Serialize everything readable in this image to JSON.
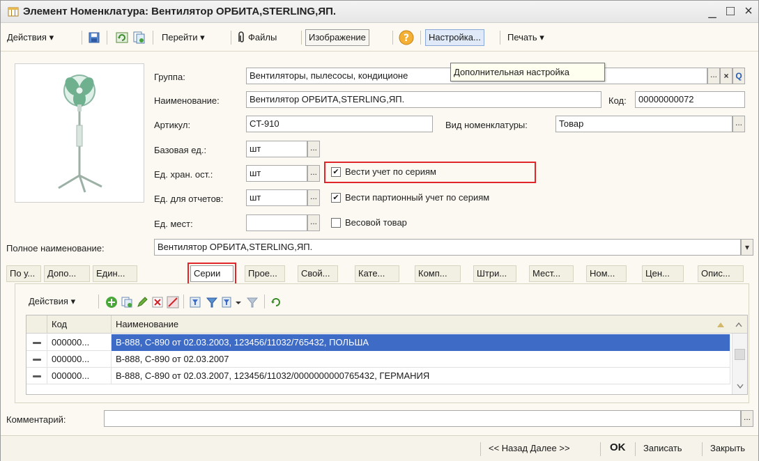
{
  "window": {
    "title": "Элемент Номенклатура: Вентилятор ОРБИТА,STERLING,ЯП.",
    "minimize": "_",
    "maximize": "□",
    "close": "×"
  },
  "toolbar": {
    "actions": "Действия ▾",
    "goto": "Перейти ▾",
    "files": "Файлы",
    "image": "Изображение",
    "help": "?",
    "settings": "Настройка...",
    "print": "Печать ▾"
  },
  "tooltip": "Дополнительная настройка",
  "form": {
    "group_label": "Группа:",
    "group_value": "Вентиляторы, пылесосы, кондиционе",
    "name_label": "Наименование:",
    "name_value": "Вентилятор ОРБИТА,STERLING,ЯП.",
    "code_label": "Код:",
    "code_value": "00000000072",
    "article_label": "Артикул:",
    "article_value": "CT-910",
    "kind_label": "Вид номенклатуры:",
    "kind_value": "Товар",
    "base_unit_label": "Базовая ед.:",
    "base_unit_value": "шт",
    "storage_unit_label": "Ед. хран. ост.:",
    "storage_unit_value": "шт",
    "report_unit_label": "Ед. для отчетов:",
    "report_unit_value": "шт",
    "places_unit_label": "Ед. мест:",
    "places_unit_value": "",
    "series_check_label": "Вести учет по сериям",
    "series_checked": "✔",
    "batch_check_label": "Вести партионный учет по сериям",
    "batch_checked": "✔",
    "weight_check_label": "Весовой товар",
    "full_name_label": "Полное наименование:",
    "full_name_value": "Вентилятор ОРБИТА,STERLING,ЯП.",
    "dots": "...",
    "dropdown": "▾",
    "clear": "×",
    "search": "Q"
  },
  "tabs": [
    "По у...",
    "Допо...",
    "Един...",
    "Серии",
    "Прое...",
    "Свой...",
    "Кате...",
    "Комп...",
    "Штри...",
    "Мест...",
    "Ном...",
    "Цен...",
    "Опис..."
  ],
  "series_panel": {
    "actions": "Действия ▾",
    "columns": {
      "code": "Код",
      "name": "Наименование"
    },
    "rows": [
      {
        "code": "000000...",
        "name": "B-888, C-890 от 02.03.2003, 123456/11032/765432, ПОЛЬША"
      },
      {
        "code": "000000...",
        "name": "B-888, C-890 от 02.03.2007"
      },
      {
        "code": "000000...",
        "name": "B-888, C-890 от 02.03.2007, 123456/11032/0000000000765432, ГЕРМАНИЯ"
      }
    ]
  },
  "comment_label": "Комментарий:",
  "comment_value": "",
  "bottom": {
    "back_next": "<< Назад  Далее >>",
    "ok": "OK",
    "save": "Записать",
    "close": "Закрыть"
  },
  "colors": {
    "selection": "#3d6bc6",
    "highlight_red": "#e0262b",
    "background": "#fbf9f1"
  }
}
